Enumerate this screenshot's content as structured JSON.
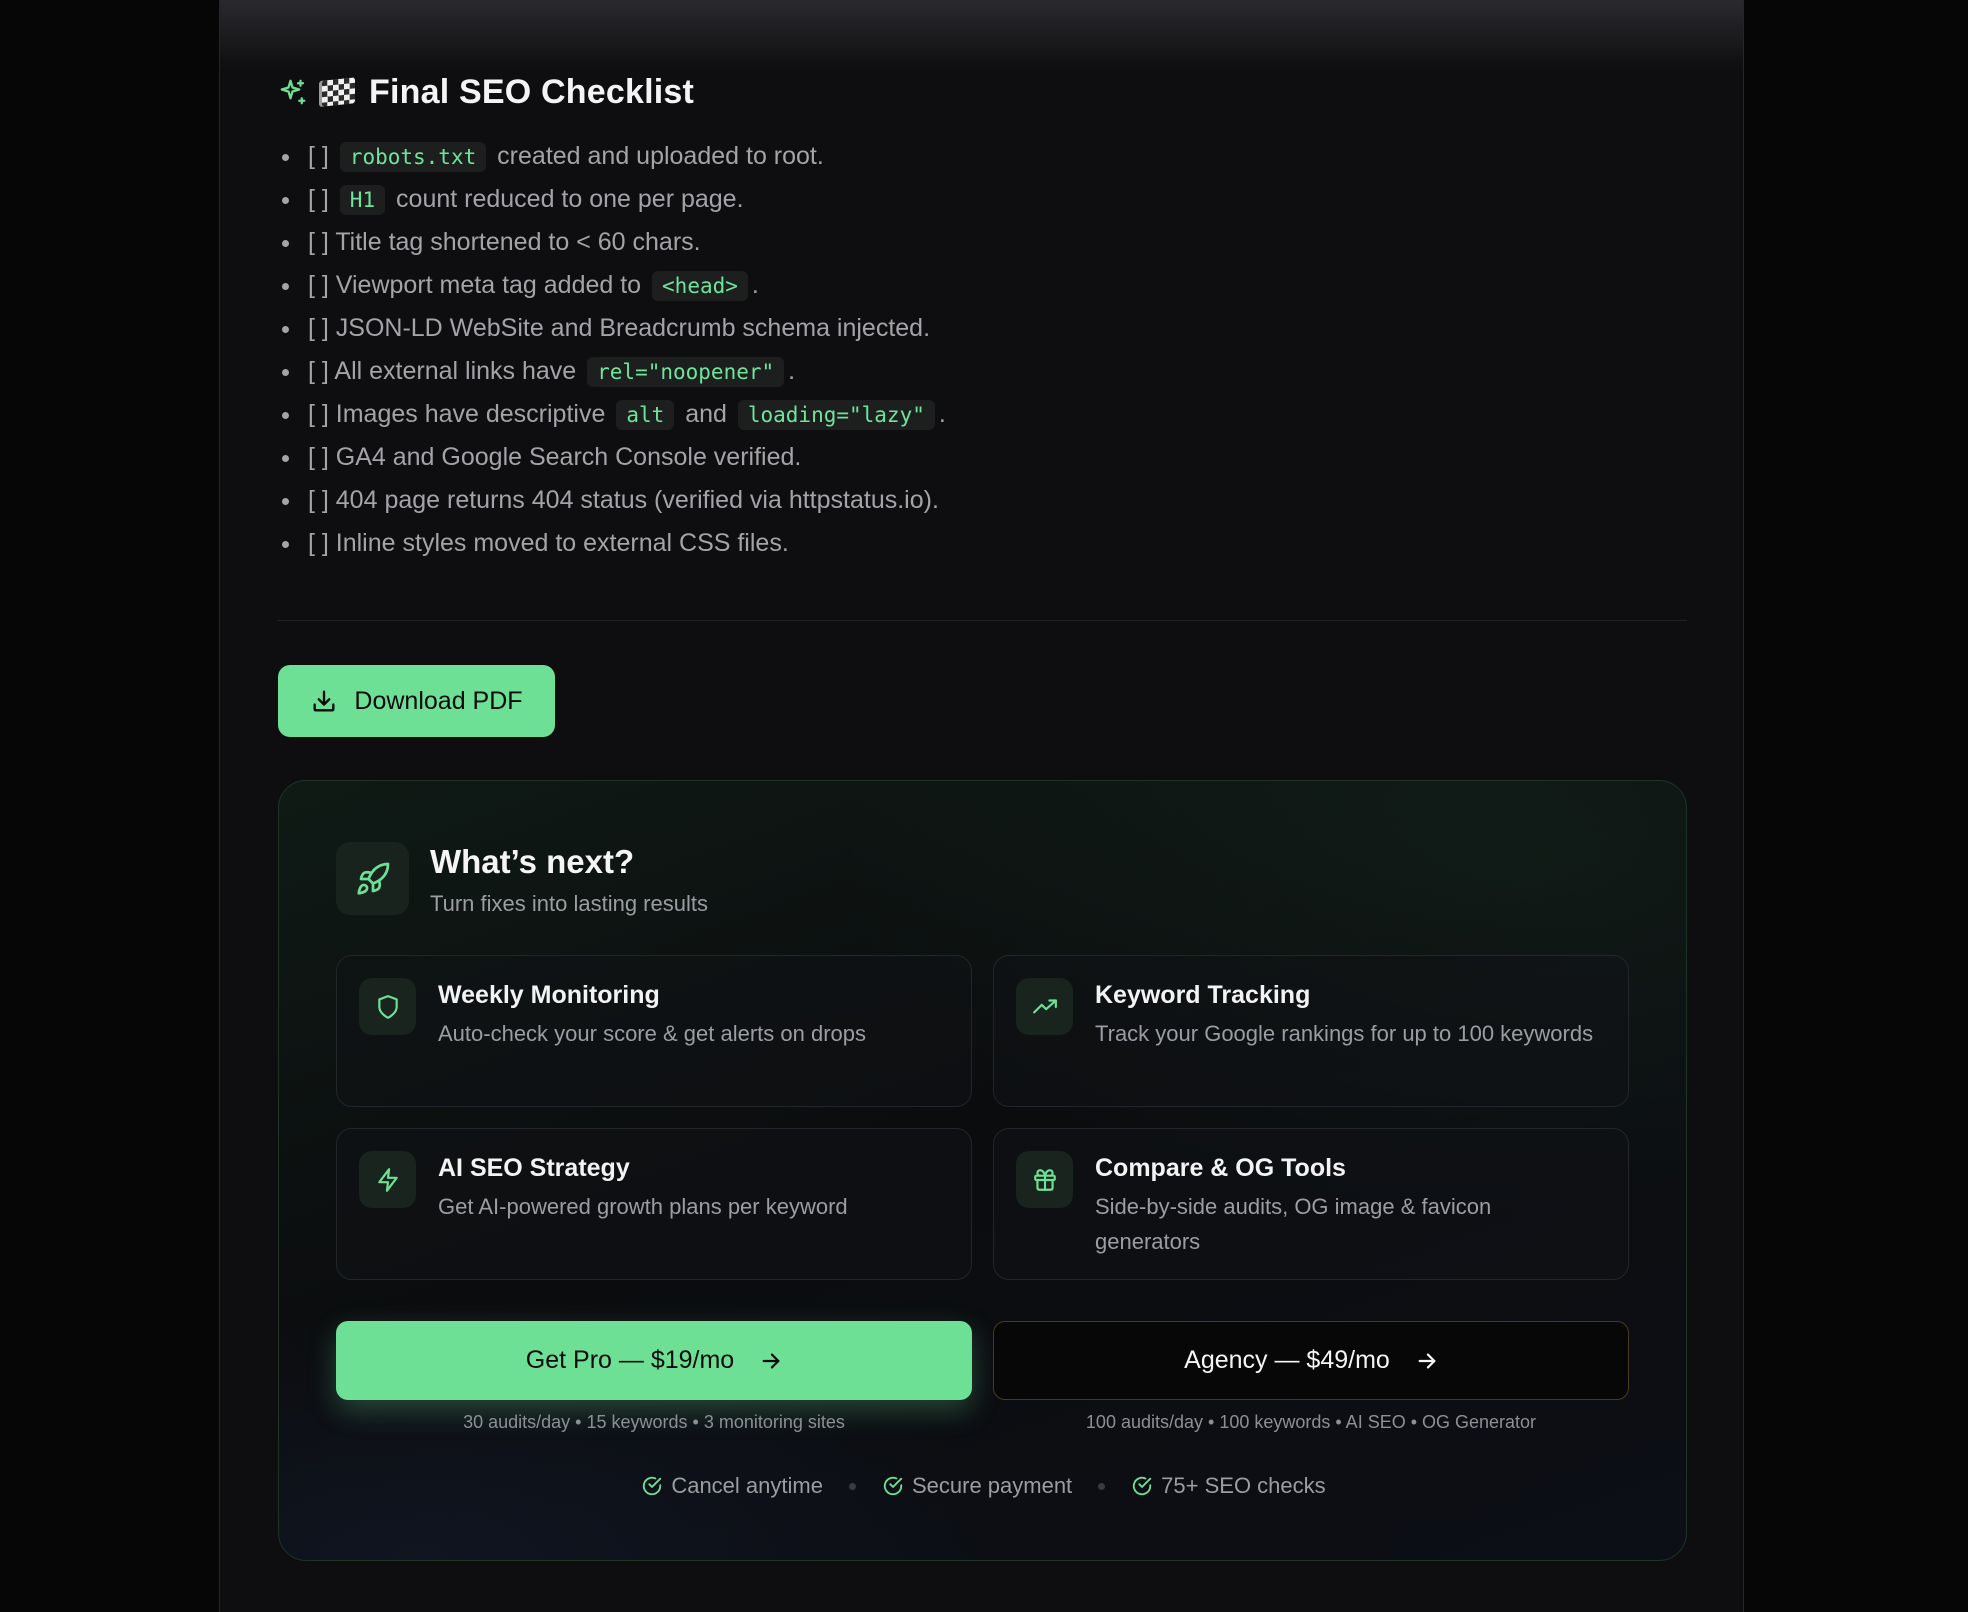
{
  "checklist": {
    "emoji": "🏁",
    "title": "Final SEO Checklist",
    "items": [
      {
        "before": "[ ] ",
        "code": "robots.txt",
        "after": " created and uploaded to root."
      },
      {
        "before": "[ ] ",
        "code": "H1",
        "after": " count reduced to one per page."
      },
      {
        "before": "[ ] Title tag shortened to < 60 chars."
      },
      {
        "before": "[ ] Viewport meta tag added to ",
        "code": "<head>",
        "after": "."
      },
      {
        "before": "[ ] JSON-LD WebSite and Breadcrumb schema injected."
      },
      {
        "before": "[ ] All external links have ",
        "code": "rel=\"noopener\"",
        "after": "."
      },
      {
        "before": "[ ] Images have descriptive ",
        "code": "alt",
        "middle": " and ",
        "code2": "loading=\"lazy\"",
        "after": "."
      },
      {
        "before": "[ ] GA4 and Google Search Console verified."
      },
      {
        "before": "[ ] 404 page returns 404 status (verified via httpstatus.io)."
      },
      {
        "before": "[ ] Inline styles moved to external CSS files."
      }
    ]
  },
  "download": {
    "label": "Download PDF",
    "icon": "download-icon"
  },
  "next": {
    "icon": "rocket-icon",
    "title": "What’s next?",
    "subtitle": "Turn fixes into lasting results",
    "features": [
      {
        "icon": "shield-icon",
        "title": "Weekly Monitoring",
        "desc": "Auto-check your score & get alerts on drops"
      },
      {
        "icon": "trending-up-icon",
        "title": "Keyword Tracking",
        "desc": "Track your Google rankings for up to 100 keywords"
      },
      {
        "icon": "zap-icon",
        "title": "AI SEO Strategy",
        "desc": "Get AI-powered growth plans per keyword"
      },
      {
        "icon": "gift-icon",
        "title": "Compare & OG Tools",
        "desc": "Side-by-side audits, OG image & favicon generators"
      }
    ],
    "pro": {
      "label": "Get Pro — $19/mo",
      "note": "30 audits/day • 15 keywords • 3 monitoring sites"
    },
    "agency": {
      "label": "Agency — $49/mo",
      "note": "100 audits/day • 100 keywords • AI SEO • OG Generator"
    },
    "trust": [
      "Cancel anytime",
      "Secure payment",
      "75+ SEO checks"
    ]
  },
  "colors": {
    "accent": "#6ee096",
    "background": "#0e0e10",
    "code_bg": "#1d1f1f"
  }
}
